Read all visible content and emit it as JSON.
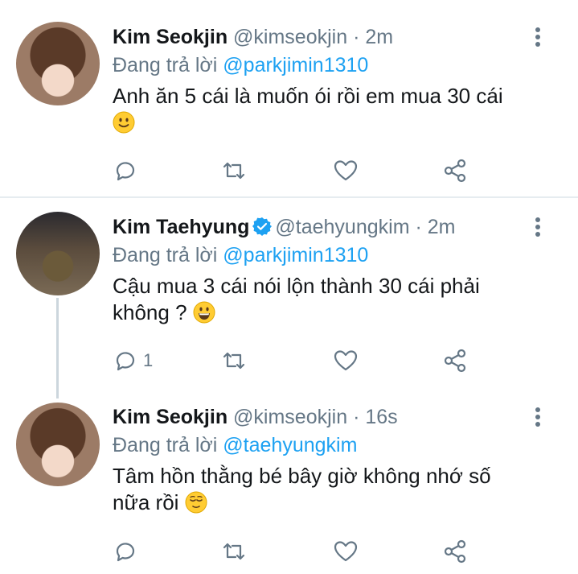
{
  "tweets": [
    {
      "name": "Kim Seokjin",
      "handle": "@kimseokjin",
      "time": "2m",
      "reply_prefix": "Đang trả lời",
      "reply_to": "@parkjimin1310",
      "text": "Anh ăn 5 cái là muốn ói rồi em mua 30 cái",
      "emoji": "slightly-smiling-face",
      "reply_count": ""
    },
    {
      "name": "Kim Taehyung",
      "handle": "@taehyungkim",
      "time": "2m",
      "reply_prefix": "Đang trả lời",
      "reply_to": "@parkjimin1310",
      "text": "Cậu mua 3 cái nói lộn thành 30 cái phải không ?",
      "emoji": "grinning-face",
      "reply_count": "1"
    },
    {
      "name": "Kim Seokjin",
      "handle": "@kimseokjin",
      "time": "16s",
      "reply_prefix": "Đang trả lời",
      "reply_to": "@taehyungkim",
      "text": "Tâm hồn thằng bé bây giờ không nhớ số nữa rồi",
      "emoji": "relieved-face",
      "reply_count": ""
    }
  ],
  "separator": " · ",
  "colors": {
    "accent": "#1da1f2",
    "secondary_text": "#657786",
    "primary_text": "#14171a",
    "icon": "#657786",
    "divider": "#e6ecf0"
  }
}
